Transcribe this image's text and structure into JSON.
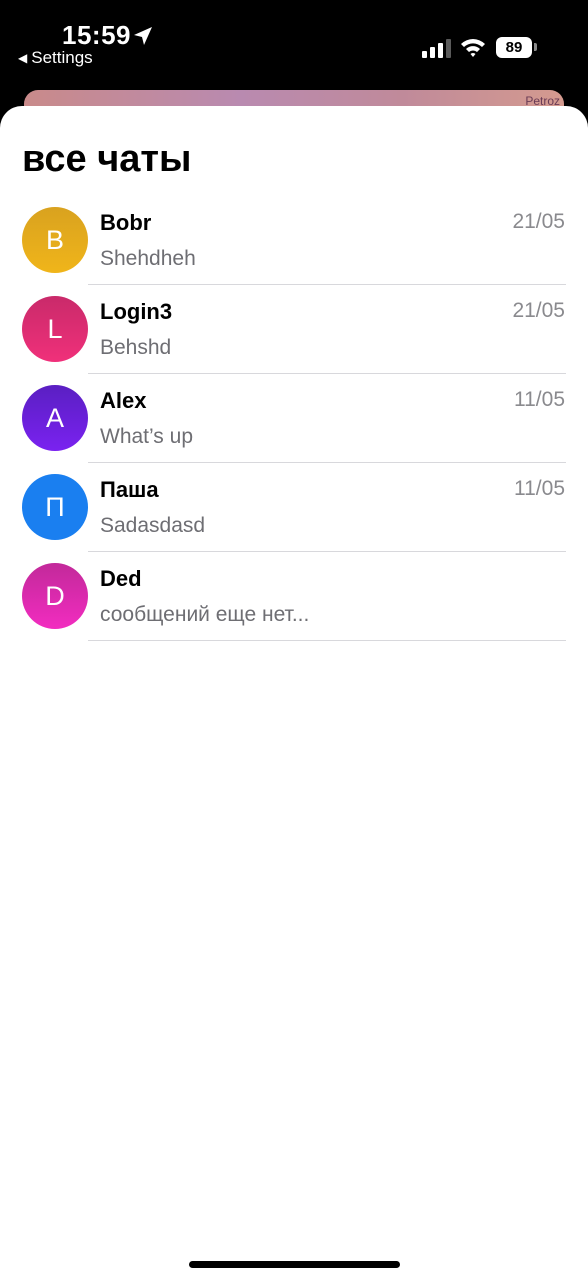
{
  "status_bar": {
    "time": "15:59",
    "back_label": "Settings",
    "battery": "89",
    "icons": [
      "location-arrow-icon",
      "signal-icon",
      "wifi-icon",
      "battery-icon"
    ]
  },
  "background": {
    "map_label": "Petroz"
  },
  "page": {
    "title": "все чаты"
  },
  "chats": [
    {
      "initial": "B",
      "name": "Bobr",
      "preview": "Shehdheh",
      "date": "21/05",
      "color_top": "#d9a21f",
      "color_bottom": "#f0b51a"
    },
    {
      "initial": "L",
      "name": "Login3",
      "preview": "Behshd",
      "date": "21/05",
      "color_top": "#c92a6a",
      "color_bottom": "#f0307a"
    },
    {
      "initial": "A",
      "name": "Alex",
      "preview": "What’s up",
      "date": "11/05",
      "color_top": "#5a1fc2",
      "color_bottom": "#7a22f0"
    },
    {
      "initial": "П",
      "name": "Паша",
      "preview": "Sadasdasd",
      "date": "11/05",
      "color_top": "#1a7ff0",
      "color_bottom": "#1a7ff0"
    },
    {
      "initial": "D",
      "name": "Ded",
      "preview": "сообщений еще нет...",
      "date": "",
      "color_top": "#c2299a",
      "color_bottom": "#f22cc0"
    }
  ]
}
